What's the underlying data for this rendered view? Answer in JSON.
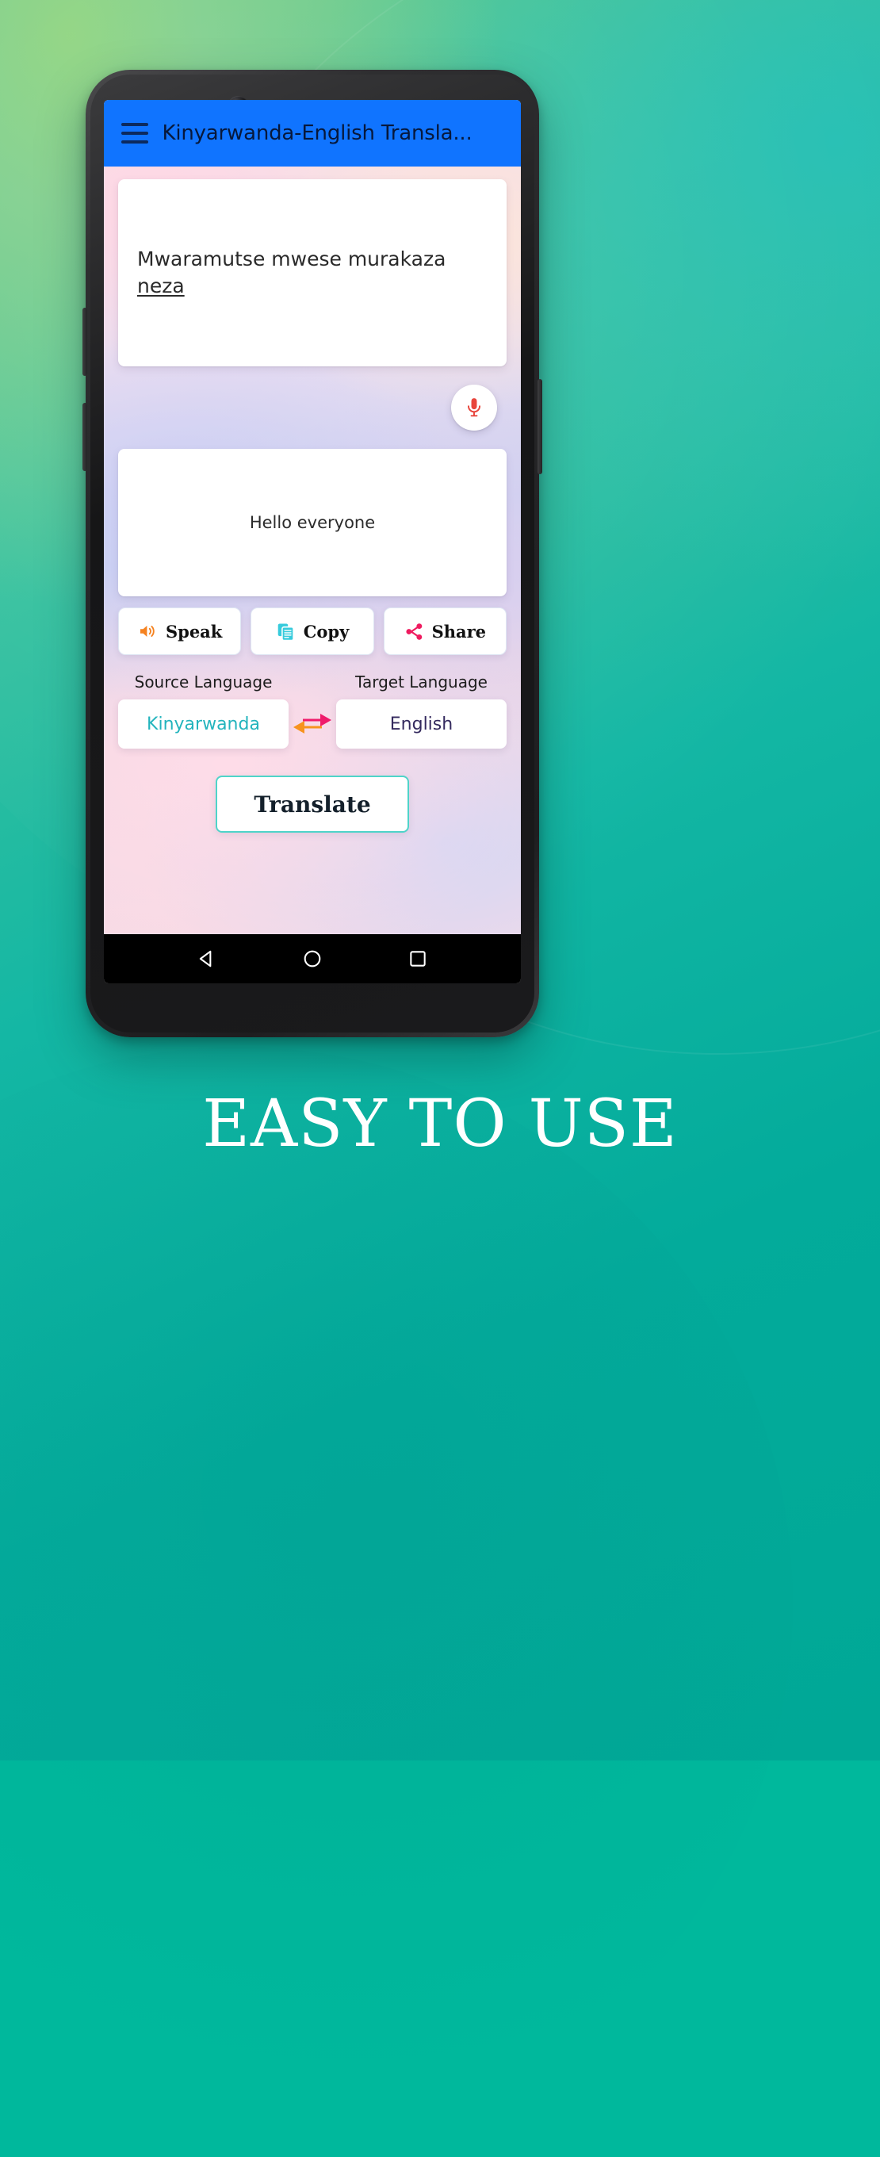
{
  "promo": {
    "caption": "EASY TO USE"
  },
  "app": {
    "appbar": {
      "menu_icon": "hamburger-menu-icon",
      "title": "Kinyarwanda-English Transla..."
    },
    "source": {
      "text_before": "Mwaramutse mwese murakaza ",
      "text_misspelled": "neza",
      "full_text": "Mwaramutse mwese murakaza neza"
    },
    "mic": {
      "icon": "microphone-icon",
      "color": "#e8453c"
    },
    "result": {
      "text": "Hello everyone"
    },
    "actions": [
      {
        "label": "Speak",
        "icon": "volume-speaker-icon",
        "color": "#f58220"
      },
      {
        "label": "Copy",
        "icon": "copy-documents-icon",
        "color": "#37cbdc"
      },
      {
        "label": "Share",
        "icon": "share-nodes-icon",
        "color": "#ef1b5f"
      }
    ],
    "language": {
      "source_label": "Source Language",
      "target_label": "Target Language",
      "source_value": "Kinyarwanda",
      "target_value": "English",
      "swap_icon": "swap-arrows-icon",
      "swap_left_color": "#f7931e",
      "swap_right_color": "#ef1b6b",
      "source_color": "#23b4bd",
      "target_color": "#342a5e"
    },
    "translate": {
      "label": "Translate",
      "border_color": "#4fd4c9"
    },
    "navbar": {
      "back": "back-triangle-icon",
      "home": "home-circle-icon",
      "recents": "recents-square-icon"
    },
    "theme": {
      "appbar_color": "#1074ff",
      "appbar_text_color": "#07183b"
    }
  }
}
